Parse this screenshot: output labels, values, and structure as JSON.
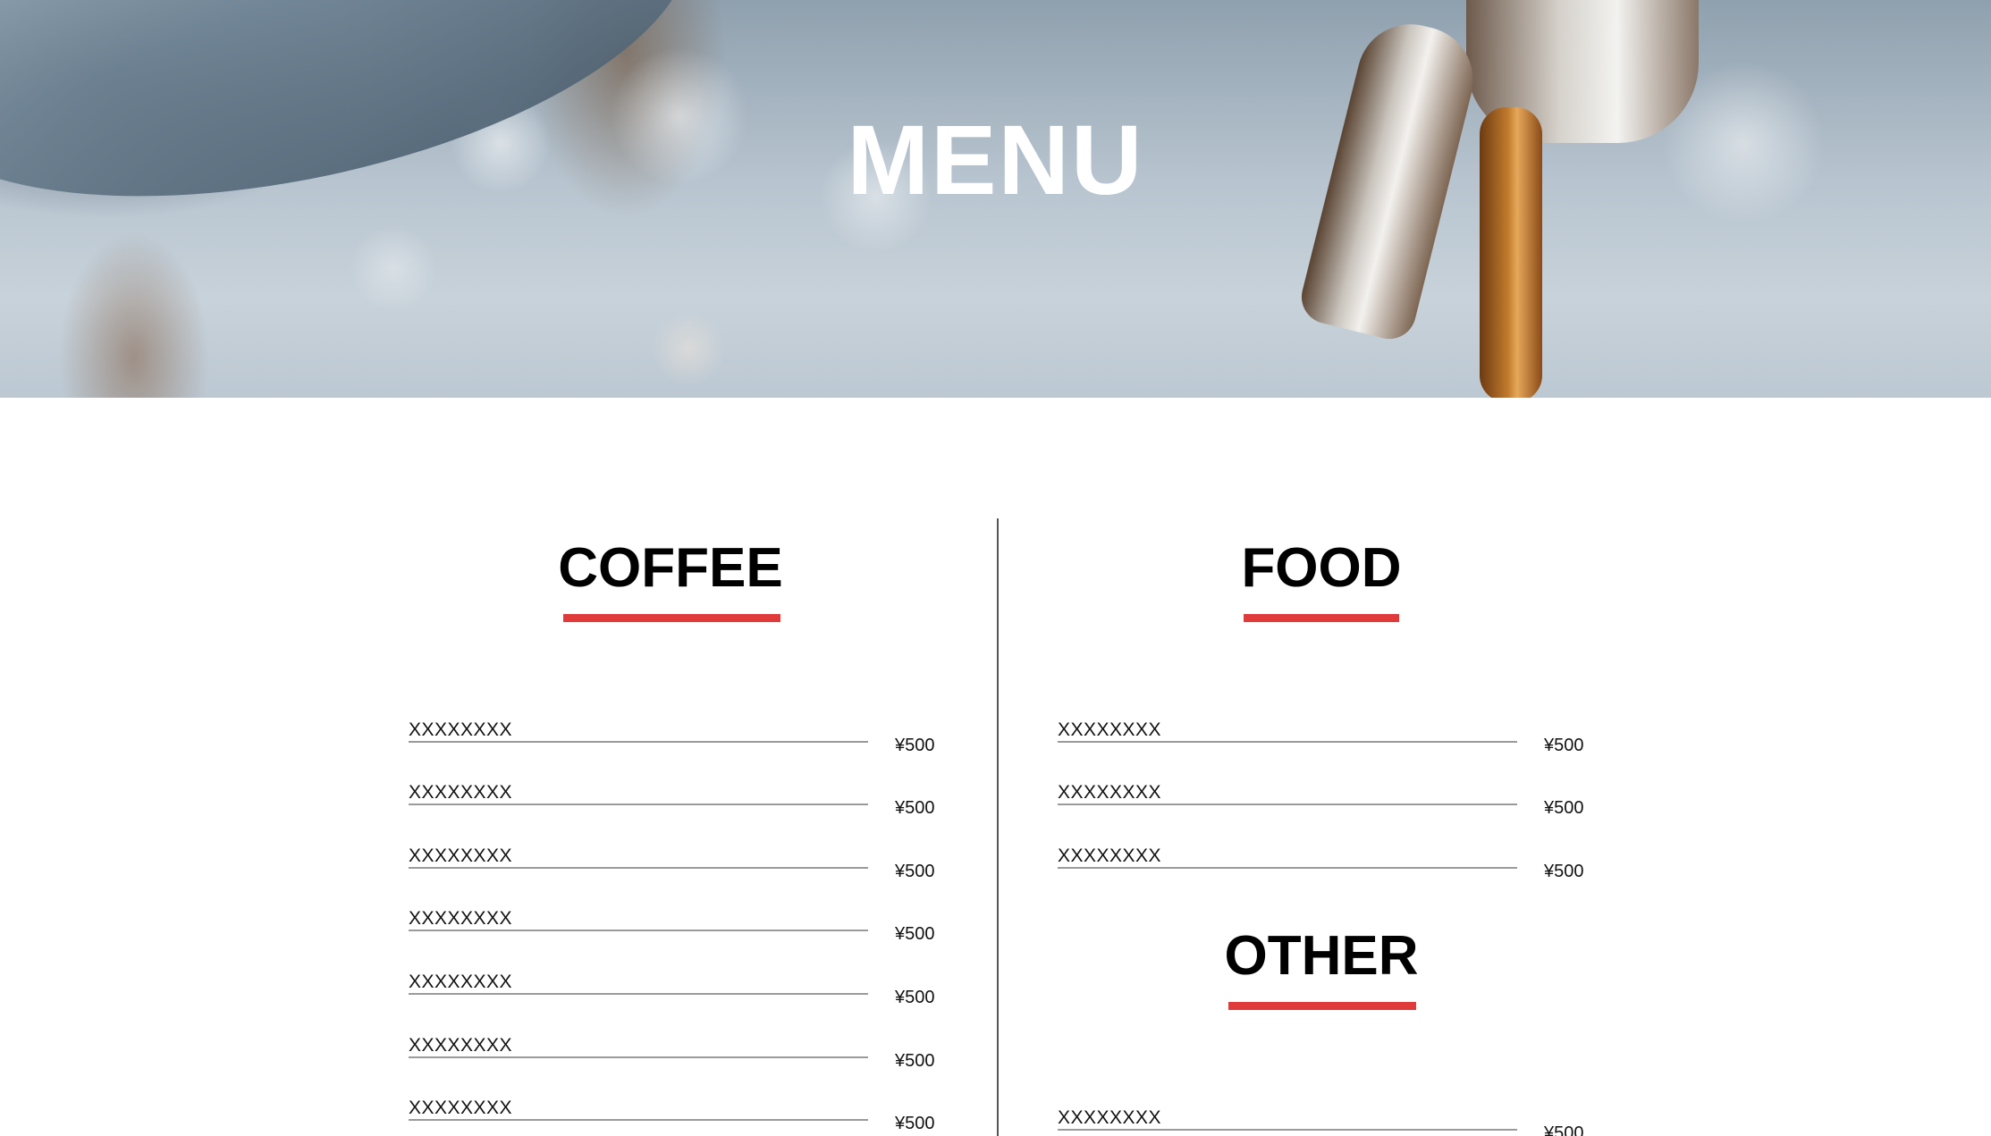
{
  "hero": {
    "title": "MENU"
  },
  "sections": {
    "coffee": {
      "title": "COFFEE",
      "items": [
        {
          "name": "XXXXXXXX",
          "price": "¥500"
        },
        {
          "name": "XXXXXXXX",
          "price": "¥500"
        },
        {
          "name": "XXXXXXXX",
          "price": "¥500"
        },
        {
          "name": "XXXXXXXX",
          "price": "¥500"
        },
        {
          "name": "XXXXXXXX",
          "price": "¥500"
        },
        {
          "name": "XXXXXXXX",
          "price": "¥500"
        },
        {
          "name": "XXXXXXXX",
          "price": "¥500"
        }
      ]
    },
    "food": {
      "title": "FOOD",
      "items": [
        {
          "name": "XXXXXXXX",
          "price": "¥500"
        },
        {
          "name": "XXXXXXXX",
          "price": "¥500"
        },
        {
          "name": "XXXXXXXX",
          "price": "¥500"
        }
      ]
    },
    "other": {
      "title": "OTHER",
      "items": [
        {
          "name": "XXXXXXXX",
          "price": "¥500"
        }
      ]
    }
  },
  "colors": {
    "accent": "#e03a3a",
    "divider": "#555555",
    "rule": "#9a9a9a"
  }
}
